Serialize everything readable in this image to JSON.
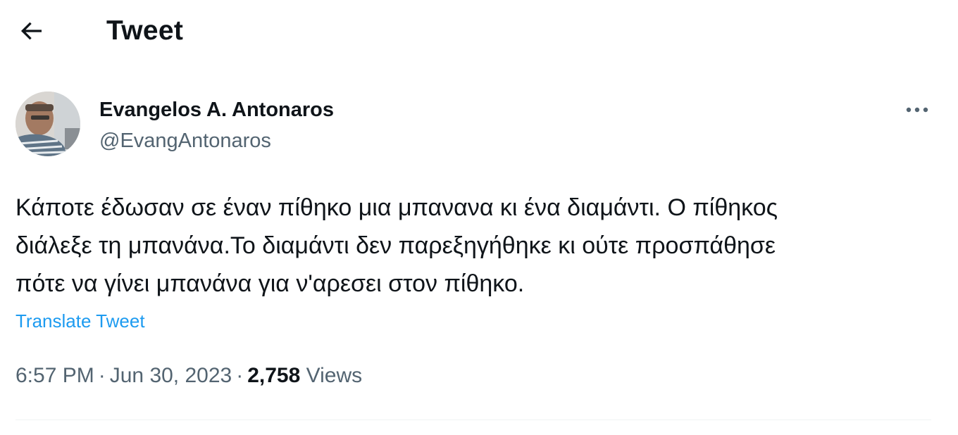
{
  "header": {
    "back_icon": "arrow-left-icon",
    "title": "Tweet"
  },
  "author": {
    "display_name": "Evangelos A. Antonaros",
    "handle": "@EvangAntonaros",
    "avatar_icon": "avatar",
    "more_icon": "more-horizontal-icon"
  },
  "tweet": {
    "text_lines": [
      "Κάποτε έδωσαν σε έναν πίθηκο μια μπανανα κι ένα διαμάντι. Ο πίθηκος",
      "διάλεξε τη μπανάνα.Το διαμάντι δεν παρεξηγήθηκε κι ούτε προσπάθησε",
      "πότε να γίνει μπανάνα για ν'αρεσει στον πίθηκο."
    ],
    "translate_label": "Translate Tweet",
    "time": "6:57 PM",
    "date": "Jun 30, 2023",
    "separator": "·",
    "views_count": "2,758",
    "views_label": "Views"
  },
  "colors": {
    "text_primary": "#0f1419",
    "text_secondary": "#536471",
    "link": "#1d9bf0",
    "divider": "#eff3f4"
  }
}
